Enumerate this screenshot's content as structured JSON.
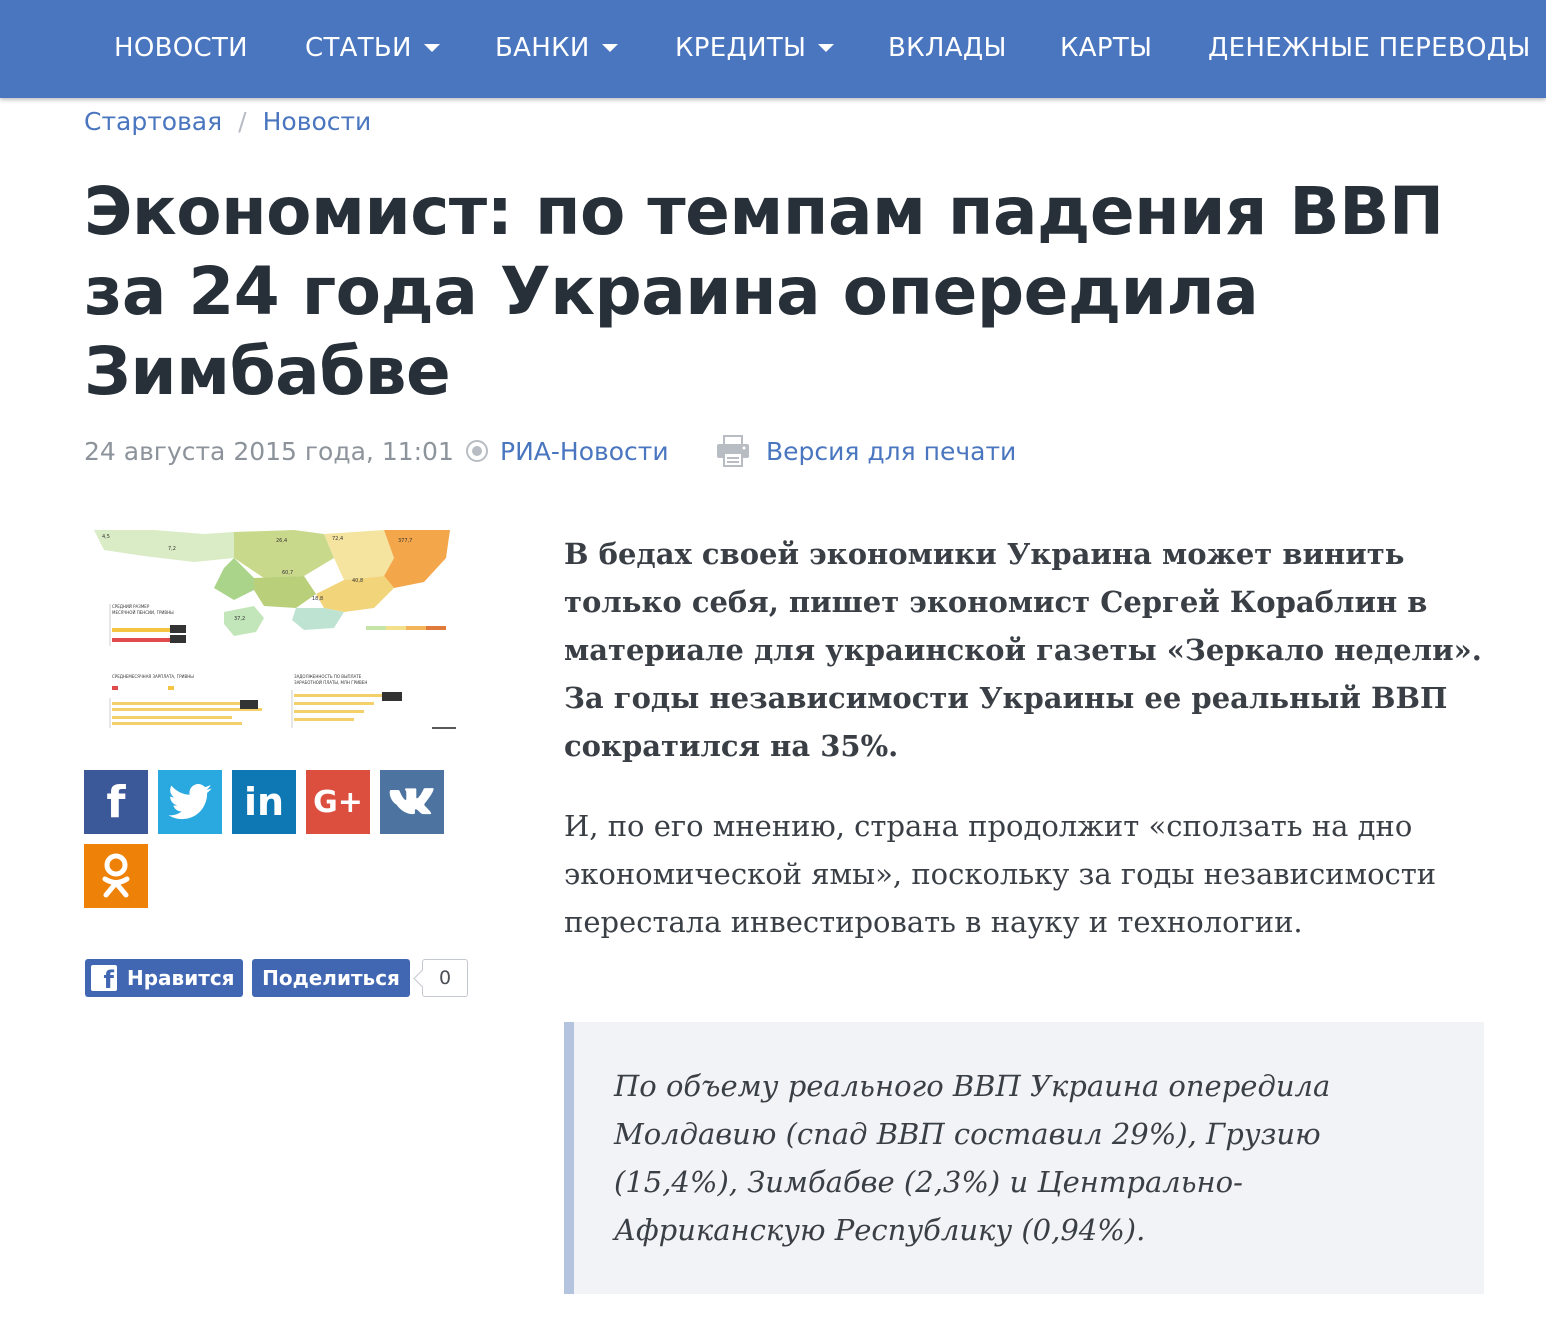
{
  "nav": {
    "items": [
      {
        "label": "НОВОСТИ",
        "dropdown": false
      },
      {
        "label": "СТАТЬИ",
        "dropdown": true
      },
      {
        "label": "БАНКИ",
        "dropdown": true
      },
      {
        "label": "КРЕДИТЫ",
        "dropdown": true
      },
      {
        "label": "ВКЛАДЫ",
        "dropdown": false
      },
      {
        "label": "КАРТЫ",
        "dropdown": false
      },
      {
        "label": "ДЕНЕЖНЫЕ ПЕРЕВОДЫ",
        "dropdown": false
      }
    ],
    "background": "#4a76bf"
  },
  "breadcrumb": {
    "home": "Стартовая",
    "separator": "/",
    "current": "Новости"
  },
  "article": {
    "title": "Экономист: по темпам падения ВВП за 24 года Украина опередила Зимбабве",
    "date": "24 августа 2015 года, 11:01",
    "source": "РИА-Новости",
    "print_label": "Версия для печати",
    "lead": "В бедах своей экономики Украина может винить только себя, пишет экономист Сергей Кораблин в материале для украинской газеты «Зеркало недели». За годы независимости Украины ее реальный ВВП сократился на 35%.",
    "paragraph": "И, по его мнению, страна продолжит «сползать на дно экономической ямы», поскольку за годы независимости перестала инвестировать в науку и технологии.",
    "quote": "По объему реального ВВП Украина опередила Молдавию (спад ВВП составил 29%), Грузию (15,4%), Зимбабве (2,3%) и Центрально-Африканскую Республику (0,94%)."
  },
  "social": {
    "buttons": [
      {
        "name": "facebook",
        "glyph": "f",
        "color": "#3b5898"
      },
      {
        "name": "twitter",
        "glyph": "bird",
        "color": "#2aa8e0"
      },
      {
        "name": "linkedin",
        "glyph": "in",
        "color": "#0e78b4"
      },
      {
        "name": "google-plus",
        "glyph": "G+",
        "color": "#dc4f3f"
      },
      {
        "name": "vk",
        "glyph": "vk",
        "color": "#4d74a0"
      },
      {
        "name": "odnoklassniki",
        "glyph": "ok",
        "color": "#ee8208"
      }
    ],
    "fb_like": "Нравится",
    "fb_share": "Поделиться",
    "fb_count": "0"
  }
}
